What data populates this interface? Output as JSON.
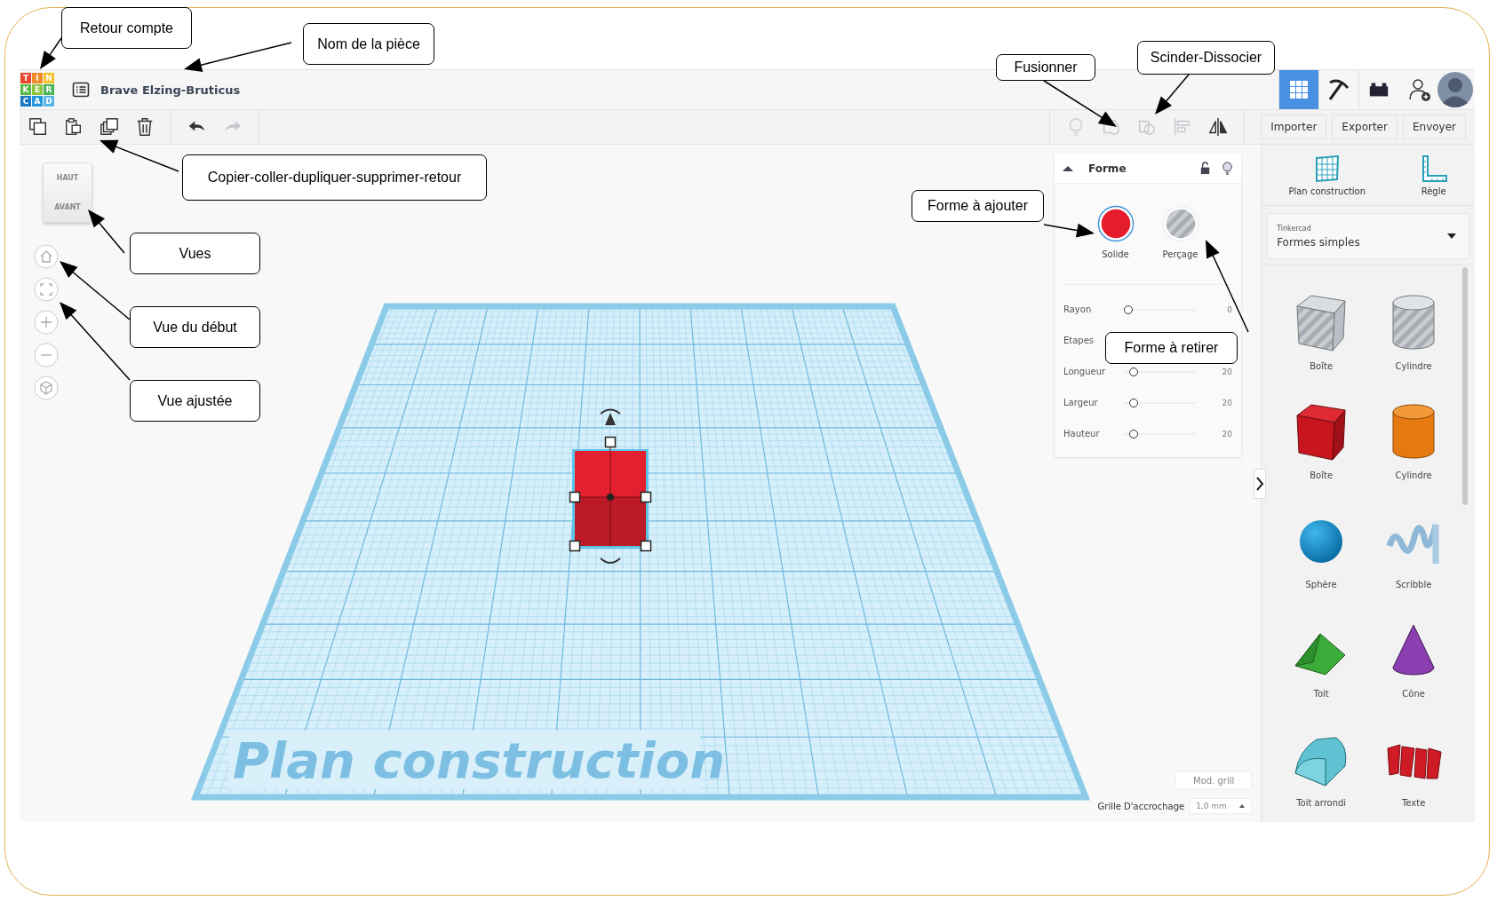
{
  "header": {
    "logo_letters": [
      {
        "letter": "T",
        "color": "#e8452c"
      },
      {
        "letter": "I",
        "color": "#f08b2a"
      },
      {
        "letter": "N",
        "color": "#f6c22b"
      },
      {
        "letter": "K",
        "color": "#5ab946"
      },
      {
        "letter": "E",
        "color": "#8cc63e"
      },
      {
        "letter": "R",
        "color": "#48b657"
      },
      {
        "letter": "C",
        "color": "#1c7bc4"
      },
      {
        "letter": "A",
        "color": "#2196e0"
      },
      {
        "letter": "D",
        "color": "#59b4e8"
      }
    ],
    "project_name": "Brave Elzing-Bruticus",
    "view_tabs": [
      {
        "kind": "grid",
        "selected": true
      },
      {
        "kind": "pickaxe",
        "selected": false
      },
      {
        "kind": "bricks",
        "selected": false
      }
    ]
  },
  "toolbar": {
    "actions": [
      {
        "kind": "copy",
        "disabled": false
      },
      {
        "kind": "paste",
        "disabled": false
      },
      {
        "kind": "duplicate",
        "disabled": false
      },
      {
        "kind": "delete",
        "disabled": false
      },
      {
        "kind": "undo",
        "disabled": false
      },
      {
        "kind": "redo",
        "disabled": true
      }
    ],
    "tools": [
      {
        "kind": "light",
        "disabled": true
      },
      {
        "kind": "group",
        "disabled": true
      },
      {
        "kind": "ungroup",
        "disabled": true
      },
      {
        "kind": "align",
        "disabled": true
      },
      {
        "kind": "mirror",
        "disabled": false
      }
    ],
    "buttons": [
      "Importer",
      "Exporter",
      "Envoyer"
    ]
  },
  "view_cube": {
    "top": "HAUT",
    "front": "AVANT"
  },
  "nav_buttons": [
    {
      "kind": "home"
    },
    {
      "kind": "fit"
    },
    {
      "kind": "zoom_in"
    },
    {
      "kind": "zoom_out"
    },
    {
      "kind": "perspective"
    }
  ],
  "workplane": {
    "label": "Plan construction"
  },
  "shape_panel": {
    "title": "Forme",
    "modes": [
      {
        "kind": "solid",
        "label": "Solide",
        "selected": true
      },
      {
        "kind": "hole",
        "label": "Perçage",
        "selected": false
      }
    ],
    "params": [
      {
        "label": "Rayon",
        "value": "0",
        "level": 0
      },
      {
        "label": "Etapes"
      },
      {
        "label": "Longueur",
        "value": "20",
        "level": 0.08
      },
      {
        "label": "Largeur",
        "value": "20",
        "level": 0.08
      },
      {
        "label": "Hauteur",
        "value": "20",
        "level": 0.08
      }
    ]
  },
  "grid_controls": {
    "edit_grid": "Mod. grill",
    "snap_label": "Grille D'accrochage",
    "snap_value": "1,0 mm"
  },
  "library": {
    "tools": [
      {
        "kind": "workplane",
        "label": "Plan construction"
      },
      {
        "kind": "ruler",
        "label": "Règle"
      }
    ],
    "source": "Tinkercad",
    "category": "Formes simples",
    "shapes": [
      {
        "kind": "box_hole",
        "label": "Boîte"
      },
      {
        "kind": "cylinder_hole",
        "label": "Cylindre"
      },
      {
        "kind": "box",
        "label": "Boîte"
      },
      {
        "kind": "cylinder",
        "label": "Cylindre"
      },
      {
        "kind": "sphere",
        "label": "Sphère"
      },
      {
        "kind": "scribble",
        "label": "Scribble"
      },
      {
        "kind": "roof",
        "label": "Toit"
      },
      {
        "kind": "cone",
        "label": "Cône"
      },
      {
        "kind": "round_roof",
        "label": "Toit arrondi"
      },
      {
        "kind": "text",
        "label": "Texte"
      }
    ]
  },
  "callouts": [
    "Retour compte",
    "Nom de la pièce",
    "Copier-coller-dupliquer-supprimer-retour",
    "Vues",
    "Vue du début",
    "Vue ajustée",
    "Fusionner",
    "Scinder-Dissocier",
    "Forme à ajouter",
    "Forme à retirer"
  ]
}
